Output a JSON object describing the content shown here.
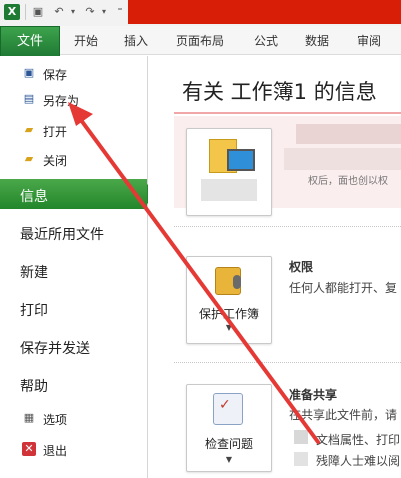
{
  "qat": {
    "app_icon": "X",
    "save_icon": "save-icon",
    "undo_icon": "undo-icon",
    "redo_icon": "redo-icon"
  },
  "ribbon": {
    "file_tab": "文件",
    "tabs": [
      "开始",
      "插入",
      "页面布局",
      "公式",
      "数据",
      "审阅"
    ]
  },
  "nav": {
    "save": "保存",
    "save_as": "另存为",
    "open": "打开",
    "close": "关闭",
    "info": "信息",
    "recent": "最近所用文件",
    "new": "新建",
    "print": "打印",
    "save_send": "保存并发送",
    "help": "帮助",
    "options": "选项",
    "exit": "退出"
  },
  "main": {
    "title": "有关 工作簿1 的信息",
    "info_partial_text": "权后，面也创以权",
    "permissions": {
      "title": "权限",
      "desc": "任何人都能打开、复",
      "button": "保护工作簿"
    },
    "share": {
      "title": "准备共享",
      "desc1": "在共享此文件前，请",
      "desc2": "文档属性、打印",
      "desc3": "残障人士难以阅",
      "button": "检查问题"
    }
  },
  "colors": {
    "accent_green": "#1f7a34",
    "nav_active": "#23862a",
    "title_red": "#d81e06",
    "annotation_arrow": "#e53935"
  }
}
